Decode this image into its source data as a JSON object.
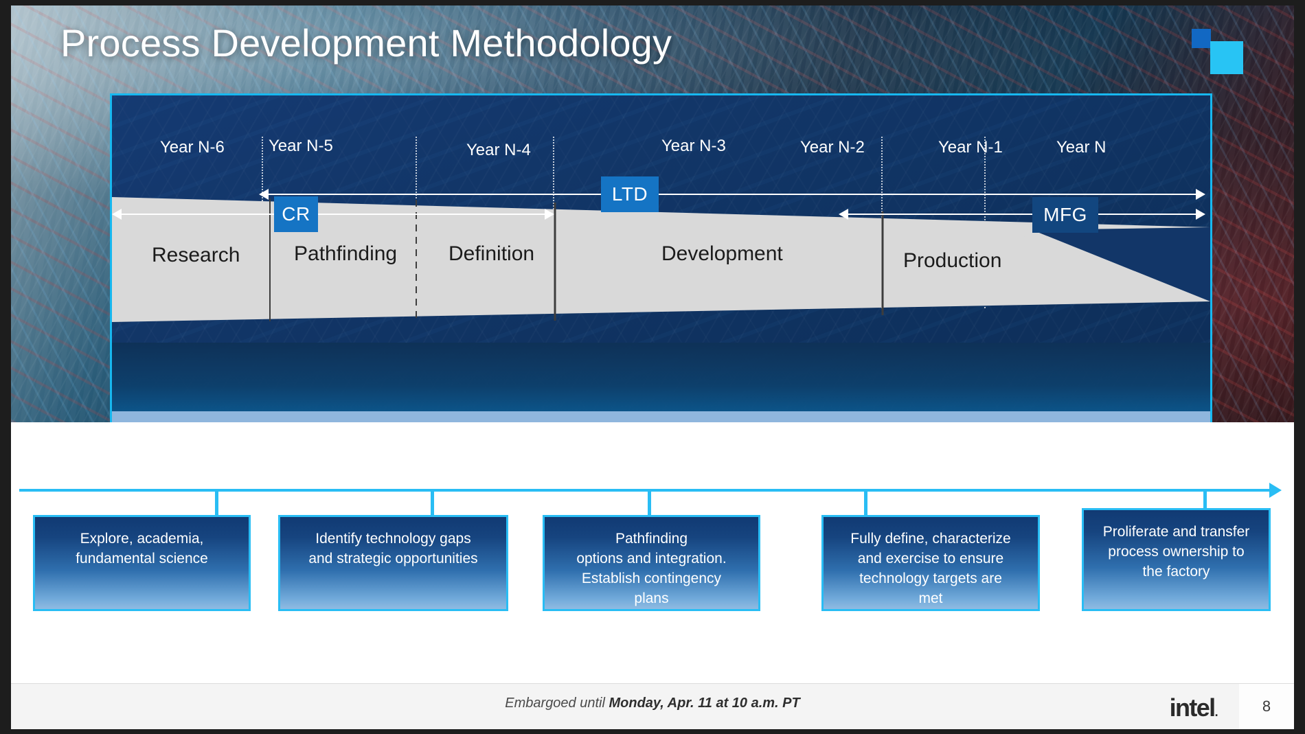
{
  "slide": {
    "title": "Process Development Methodology",
    "page_number": "8"
  },
  "timeline": {
    "years": [
      {
        "label": "Year N-6"
      },
      {
        "label": "Year N-5"
      },
      {
        "label": "Year N-4"
      },
      {
        "label": "Year N-3"
      },
      {
        "label": "Year N-2"
      },
      {
        "label": "Year N-1"
      },
      {
        "label": "Year N"
      }
    ],
    "tags": [
      {
        "id": "cr",
        "label": "CR"
      },
      {
        "id": "ltd",
        "label": "LTD"
      },
      {
        "id": "mfg",
        "label": "MFG"
      }
    ]
  },
  "stages": [
    {
      "label": "Research"
    },
    {
      "label": "Pathfinding"
    },
    {
      "label": "Definition"
    },
    {
      "label": "Development"
    },
    {
      "label": "Production"
    }
  ],
  "descriptions": [
    {
      "text": "Explore, academia,\nfundamental science"
    },
    {
      "text": "Identify technology gaps\nand strategic opportunities"
    },
    {
      "text": "Pathfinding\noptions and integration.\nEstablish contingency\nplans"
    },
    {
      "text": "Fully define, characterize\nand exercise to ensure\ntechnology targets are\nmet"
    },
    {
      "text": "Proliferate and transfer\nprocess ownership to\nthe factory"
    }
  ],
  "footer": {
    "embargo_prefix": "Embargoed until ",
    "embargo_bold": "Monday, Apr. 11 at 10 a.m. PT",
    "brand": "intel",
    "brand_dot": "."
  },
  "colors": {
    "cyan": "#29bdf4",
    "panel_blue": "#123668",
    "tag_blue": "#1574c4",
    "funnel_gray": "#d9d9d9"
  },
  "chart_data": {
    "type": "timeline",
    "title": "Process Development Methodology",
    "categories": [
      "Year N-6",
      "Year N-5",
      "Year N-4",
      "Year N-3",
      "Year N-2",
      "Year N-1",
      "Year N"
    ],
    "phases": [
      {
        "name": "Research",
        "start": "Year N-6",
        "end": "Year N-5"
      },
      {
        "name": "Pathfinding",
        "start": "Year N-5",
        "end": "Year N-4"
      },
      {
        "name": "Definition",
        "start": "Year N-4",
        "end": "Year N-3"
      },
      {
        "name": "Development",
        "start": "Year N-3",
        "end": "Year N-1"
      },
      {
        "name": "Production",
        "start": "Year N-1",
        "end": "Year N"
      }
    ],
    "spans": [
      {
        "name": "CR",
        "from": "Year N-5",
        "to": "Year N-3",
        "direction": "both"
      },
      {
        "name": "LTD",
        "from": "Year N-5",
        "to": "Year N-3",
        "direction": "both"
      },
      {
        "name": "MFG",
        "from": "Year N-1",
        "to": "Year N",
        "direction": "both"
      }
    ]
  }
}
